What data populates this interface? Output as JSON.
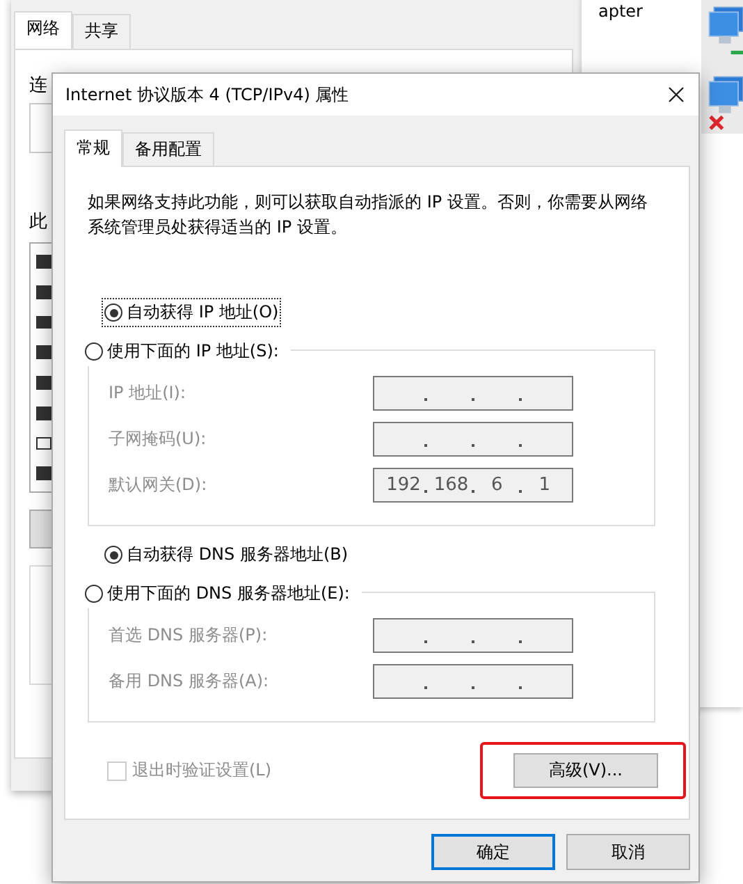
{
  "back_window": {
    "tabs": [
      {
        "label": "网络",
        "selected": true
      },
      {
        "label": "共享",
        "selected": false
      }
    ],
    "fragments": [
      "连",
      "此"
    ],
    "list_checks": [
      true,
      true,
      true,
      true,
      true,
      true,
      false,
      true
    ]
  },
  "explorer": {
    "fragment": "apter",
    "items": [
      {
        "kind": "connected"
      },
      {
        "kind": "disconnected"
      }
    ]
  },
  "dialog": {
    "title": "Internet 协议版本 4 (TCP/IPv4) 属性",
    "tabs": [
      {
        "label": "常规",
        "selected": true
      },
      {
        "label": "备用配置",
        "selected": false
      }
    ],
    "description": "如果网络支持此功能，则可以获取自动指派的 IP 设置。否则，你需要从网络系统管理员处获得适当的 IP 设置。",
    "sections": [
      {
        "auto": {
          "label": "自动获得 IP 地址(O)",
          "selected": true,
          "focused": true
        },
        "manual": {
          "label": "使用下面的 IP 地址(S):",
          "selected": false
        },
        "fields": [
          {
            "label": "IP 地址(I):",
            "disabled": true
          },
          {
            "label": "子网掩码(U):",
            "disabled": true
          },
          {
            "label": "默认网关(D):",
            "disabled": true,
            "octets": [
              "192",
              "168",
              "6",
              "1"
            ]
          }
        ]
      },
      {
        "auto": {
          "label": "自动获得 DNS 服务器地址(B)",
          "selected": true,
          "focused": false
        },
        "manual": {
          "label": "使用下面的 DNS 服务器地址(E):",
          "selected": false
        },
        "fields": [
          {
            "label": "首选 DNS 服务器(P):",
            "disabled": true
          },
          {
            "label": "备用 DNS 服务器(A):",
            "disabled": true
          }
        ]
      }
    ],
    "validate": {
      "label": "退出时验证设置(L)",
      "checked": false,
      "disabled": true
    },
    "advanced": {
      "label": "高级(V)...",
      "highlighted": true
    },
    "buttons": [
      {
        "label": "确定",
        "default": true
      },
      {
        "label": "取消",
        "default": false
      }
    ]
  }
}
